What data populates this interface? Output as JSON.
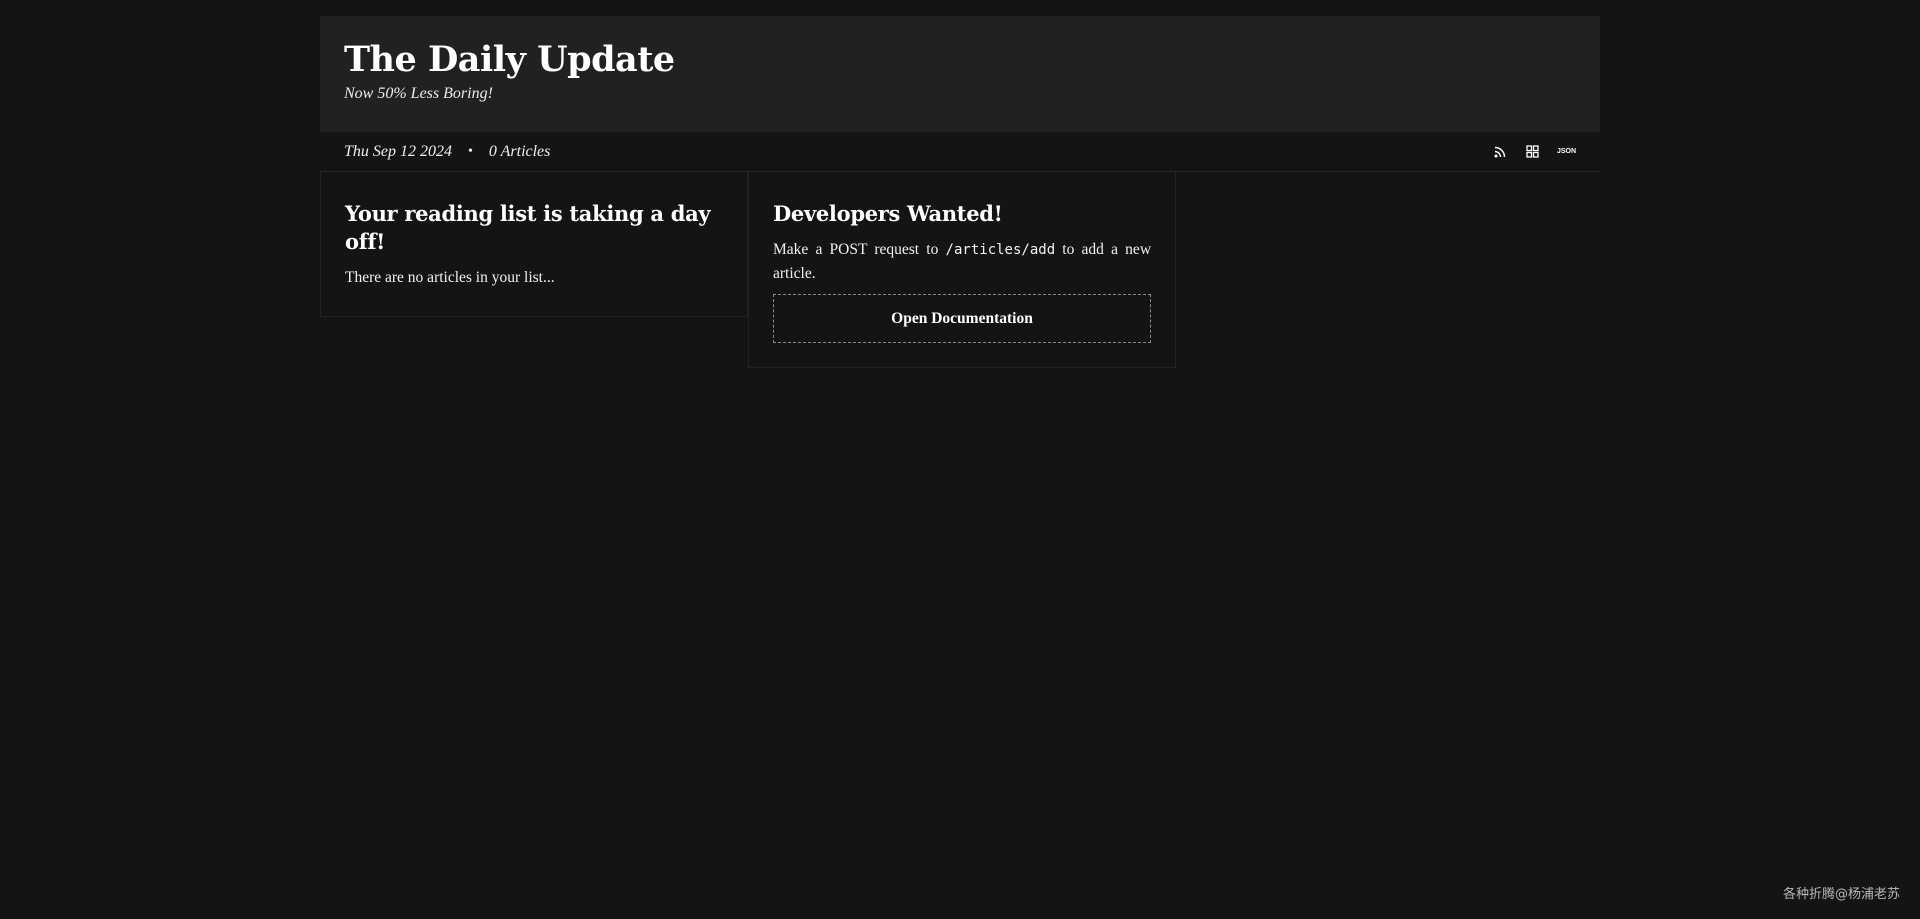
{
  "header": {
    "title": "The Daily Update",
    "tagline": "Now 50% Less Boring!"
  },
  "meta": {
    "date": "Thu Sep 12 2024",
    "separator": "•",
    "article_count": "0 Articles",
    "icons": [
      "rss-icon",
      "grid-icon",
      "json-icon"
    ],
    "json_label": "JSON"
  },
  "empty_card": {
    "title": "Your reading list is taking a day off!",
    "body": "There are no articles in your list..."
  },
  "dev_card": {
    "title": "Developers Wanted!",
    "body_before": "Make a POST request to ",
    "code": "/articles/add",
    "body_after": " to add a new article.",
    "button_label": "Open Documentation"
  },
  "watermark": "各种折腾@杨浦老苏"
}
